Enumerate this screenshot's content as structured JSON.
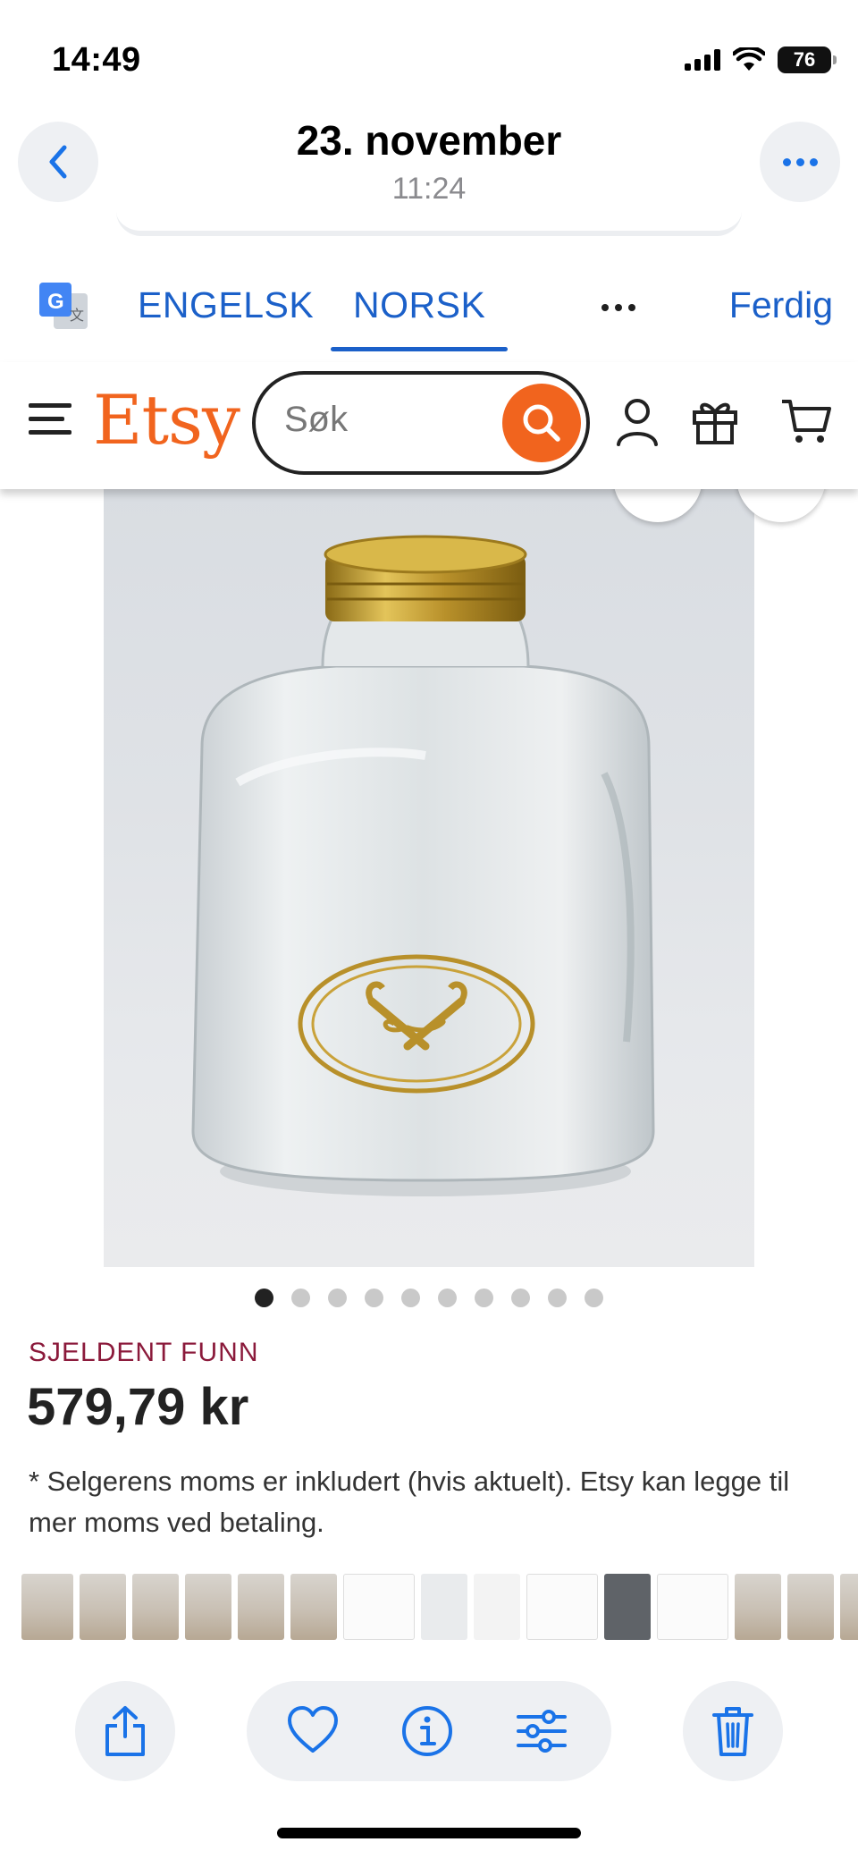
{
  "status_bar": {
    "time": "14:49",
    "battery": "76"
  },
  "photo_header": {
    "date": "23. november",
    "time": "11:24"
  },
  "translate_bar": {
    "source_lang": "ENGELSK",
    "target_lang": "NORSK",
    "active": "NORSK",
    "done_label": "Ferdig"
  },
  "etsy": {
    "logo": "Etsy",
    "search_placeholder": "Søk",
    "accent": "#f1641e"
  },
  "listing": {
    "badge": "SJELDENT FUNN",
    "price": "579,79 kr",
    "vat_note": "* Selgerens moms er inkludert (hvis aktuelt). Etsy kan legge til mer moms ved betaling.",
    "image_count": 10,
    "active_image_index": 0
  },
  "colors": {
    "translate_blue": "#1b60c9",
    "badge": "#8b1a3b",
    "toolbar_icon": "#1a73e8"
  }
}
